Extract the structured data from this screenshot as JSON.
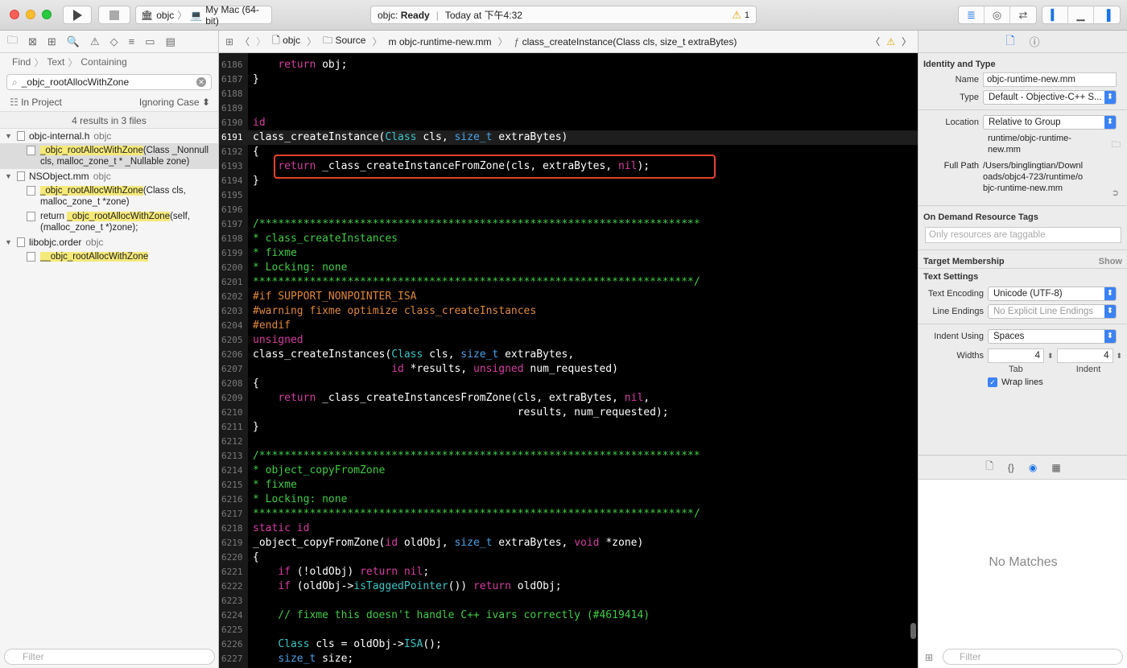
{
  "toolbar": {
    "scheme": "objc",
    "destination": "My Mac (64-bit)",
    "status_project": "objc:",
    "status_state": "Ready",
    "status_time": "Today at 下午4:32",
    "warning_count": "1"
  },
  "navigator": {
    "find_path": [
      "Find",
      "Text",
      "Containing"
    ],
    "search_value": "_objc_rootAllocWithZone",
    "scope": "In Project",
    "matching": "Ignoring Case",
    "summary": "4 results in 3 files",
    "filter_placeholder": "Filter",
    "groups": [
      {
        "file": "objc-internal.h",
        "target": "objc",
        "results": [
          {
            "pre": "",
            "match": "_objc_rootAllocWithZone",
            "post": "(Class _Nonnull cls, malloc_zone_t * _Nullable zone)",
            "selected": true
          }
        ]
      },
      {
        "file": "NSObject.mm",
        "target": "objc",
        "results": [
          {
            "pre": "",
            "match": "_objc_rootAllocWithZone",
            "post": "(Class cls, malloc_zone_t *zone)",
            "selected": false
          },
          {
            "pre": "return ",
            "match": "_objc_rootAllocWithZone",
            "post": "(self, (malloc_zone_t *)zone);",
            "selected": false
          }
        ]
      },
      {
        "file": "libobjc.order",
        "target": "objc",
        "results": [
          {
            "pre": "",
            "match": "__objc_rootAllocWithZone",
            "post": "",
            "selected": false
          }
        ]
      }
    ]
  },
  "jumpbar": {
    "items": [
      "objc",
      "Source",
      "objc-runtime-new.mm",
      "class_createInstance(Class cls, size_t extraBytes)"
    ]
  },
  "editor": {
    "current_line": "6191",
    "lines": [
      {
        "n": "6186",
        "t": [
          [
            "    ",
            ""
          ],
          [
            "return",
            "kw"
          ],
          [
            " obj;",
            ""
          ]
        ]
      },
      {
        "n": "6187",
        "t": [
          [
            "}",
            ""
          ]
        ]
      },
      {
        "n": "6188",
        "t": []
      },
      {
        "n": "6189",
        "t": []
      },
      {
        "n": "6190",
        "t": [
          [
            "id",
            "kw"
          ]
        ]
      },
      {
        "n": "6191",
        "t": [
          [
            "class_createInstance(",
            ""
          ],
          [
            "Class",
            "fn"
          ],
          [
            " cls, ",
            ""
          ],
          [
            "size_t",
            "ty"
          ],
          [
            " extraBytes)",
            ""
          ]
        ]
      },
      {
        "n": "6192",
        "t": [
          [
            "{",
            ""
          ]
        ]
      },
      {
        "n": "6193",
        "t": [
          [
            "    ",
            ""
          ],
          [
            "return",
            "kw"
          ],
          [
            " _class_createInstanceFromZone(cls, extraBytes, ",
            ""
          ],
          [
            "nil",
            "kw"
          ],
          [
            ");",
            ""
          ]
        ]
      },
      {
        "n": "6194",
        "t": [
          [
            "}",
            ""
          ]
        ]
      },
      {
        "n": "6195",
        "t": []
      },
      {
        "n": "6196",
        "t": []
      },
      {
        "n": "6197",
        "t": [
          [
            "/**********************************************************************",
            "cm"
          ]
        ]
      },
      {
        "n": "6198",
        "t": [
          [
            "* class_createInstances",
            "cm"
          ]
        ]
      },
      {
        "n": "6199",
        "t": [
          [
            "* fixme",
            "cm"
          ]
        ]
      },
      {
        "n": "6200",
        "t": [
          [
            "* Locking: none",
            "cm"
          ]
        ]
      },
      {
        "n": "6201",
        "t": [
          [
            "**********************************************************************/",
            "cm"
          ]
        ]
      },
      {
        "n": "6202",
        "t": [
          [
            "#if SUPPORT_NONPOINTER_ISA",
            "pp"
          ]
        ]
      },
      {
        "n": "6203",
        "t": [
          [
            "#warning fixme optimize class_createInstances",
            "pp"
          ]
        ]
      },
      {
        "n": "6204",
        "t": [
          [
            "#endif",
            "pp"
          ]
        ]
      },
      {
        "n": "6205",
        "t": [
          [
            "unsigned",
            "kw"
          ]
        ]
      },
      {
        "n": "6206",
        "t": [
          [
            "class_createInstances(",
            ""
          ],
          [
            "Class",
            "fn"
          ],
          [
            " cls, ",
            ""
          ],
          [
            "size_t",
            "ty"
          ],
          [
            " extraBytes,",
            ""
          ]
        ]
      },
      {
        "n": "6207",
        "t": [
          [
            "                      ",
            ""
          ],
          [
            "id",
            "kw"
          ],
          [
            " *results, ",
            ""
          ],
          [
            "unsigned",
            "kw"
          ],
          [
            " num_requested)",
            ""
          ]
        ]
      },
      {
        "n": "6208",
        "t": [
          [
            "{",
            ""
          ]
        ]
      },
      {
        "n": "6209",
        "t": [
          [
            "    ",
            ""
          ],
          [
            "return",
            "kw"
          ],
          [
            " _class_createInstancesFromZone(cls, extraBytes, ",
            ""
          ],
          [
            "nil",
            "kw"
          ],
          [
            ",",
            ""
          ]
        ]
      },
      {
        "n": "6210",
        "t": [
          [
            "                                          results, num_requested);",
            ""
          ]
        ]
      },
      {
        "n": "6211",
        "t": [
          [
            "}",
            ""
          ]
        ]
      },
      {
        "n": "6212",
        "t": []
      },
      {
        "n": "6213",
        "t": [
          [
            "/**********************************************************************",
            "cm"
          ]
        ]
      },
      {
        "n": "6214",
        "t": [
          [
            "* object_copyFromZone",
            "cm"
          ]
        ]
      },
      {
        "n": "6215",
        "t": [
          [
            "* fixme",
            "cm"
          ]
        ]
      },
      {
        "n": "6216",
        "t": [
          [
            "* Locking: none",
            "cm"
          ]
        ]
      },
      {
        "n": "6217",
        "t": [
          [
            "**********************************************************************/",
            "cm"
          ]
        ]
      },
      {
        "n": "6218",
        "t": [
          [
            "static",
            "kw"
          ],
          [
            " ",
            ""
          ],
          [
            "id",
            "kw"
          ]
        ]
      },
      {
        "n": "6219",
        "t": [
          [
            "_object_copyFromZone(",
            ""
          ],
          [
            "id",
            "kw"
          ],
          [
            " oldObj, ",
            ""
          ],
          [
            "size_t",
            "ty"
          ],
          [
            " extraBytes, ",
            ""
          ],
          [
            "void",
            "kw"
          ],
          [
            " *zone)",
            ""
          ]
        ]
      },
      {
        "n": "6220",
        "t": [
          [
            "{",
            ""
          ]
        ]
      },
      {
        "n": "6221",
        "t": [
          [
            "    ",
            ""
          ],
          [
            "if",
            "kw"
          ],
          [
            " (!oldObj) ",
            ""
          ],
          [
            "return",
            "kw"
          ],
          [
            " ",
            ""
          ],
          [
            "nil",
            "kw"
          ],
          [
            ";",
            ""
          ]
        ]
      },
      {
        "n": "6222",
        "t": [
          [
            "    ",
            ""
          ],
          [
            "if",
            "kw"
          ],
          [
            " (oldObj->",
            ""
          ],
          [
            "isTaggedPointer",
            "fn"
          ],
          [
            "()) ",
            ""
          ],
          [
            "return",
            "kw"
          ],
          [
            " oldObj;",
            ""
          ]
        ]
      },
      {
        "n": "6223",
        "t": []
      },
      {
        "n": "6224",
        "t": [
          [
            "    // fixme this doesn't handle C++ ivars correctly (#4619414)",
            "cm"
          ]
        ]
      },
      {
        "n": "6225",
        "t": []
      },
      {
        "n": "6226",
        "t": [
          [
            "    ",
            ""
          ],
          [
            "Class",
            "fn"
          ],
          [
            " cls = oldObj->",
            ""
          ],
          [
            "ISA",
            "fn"
          ],
          [
            "();",
            ""
          ]
        ]
      },
      {
        "n": "6227",
        "t": [
          [
            "    ",
            ""
          ],
          [
            "size_t",
            "ty"
          ],
          [
            " size;",
            ""
          ]
        ]
      }
    ]
  },
  "inspector": {
    "identity_title": "Identity and Type",
    "name_label": "Name",
    "name_value": "objc-runtime-new.mm",
    "type_label": "Type",
    "type_value": "Default - Objective-C++ S...",
    "location_label": "Location",
    "location_value": "Relative to Group",
    "location_path": "runtime/objc-runtime-new.mm",
    "fullpath_label": "Full Path",
    "fullpath_value": "/Users/binglingtian/Downloads/objc4-723/runtime/objc-runtime-new.mm",
    "ondemand_title": "On Demand Resource Tags",
    "tags_placeholder": "Only resources are taggable",
    "target_title": "Target Membership",
    "show_label": "Show",
    "text_settings_title": "Text Settings",
    "encoding_label": "Text Encoding",
    "encoding_value": "Unicode (UTF-8)",
    "line_endings_label": "Line Endings",
    "line_endings_value": "No Explicit Line Endings",
    "indent_using_label": "Indent Using",
    "indent_using_value": "Spaces",
    "widths_label": "Widths",
    "tab_width": "4",
    "indent_width": "4",
    "tab_caption": "Tab",
    "indent_caption": "Indent",
    "wrap_label": "Wrap lines",
    "no_matches": "No Matches",
    "filter_placeholder": "Filter"
  },
  "colors": {
    "accent": "#1a73e8",
    "highlight_box": "#e6432b",
    "keyword": "#d33ea0",
    "type": "#4aa3e8",
    "comment": "#41cc45",
    "preprocessor": "#e08839"
  }
}
